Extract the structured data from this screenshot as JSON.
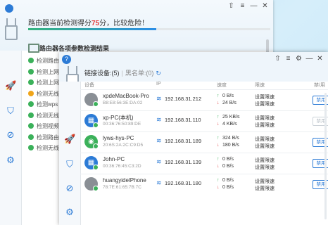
{
  "back_window": {
    "score_prefix": "路由器当前检测得分",
    "score": "75",
    "score_suffix": "分，比较危险！",
    "progress": 0.53,
    "list_title": "路由器各项参数检测结果",
    "items": [
      {
        "label": "检测路由器",
        "status": "ok"
      },
      {
        "label": "检测上网",
        "status": "ok"
      },
      {
        "label": "检测上网",
        "status": "ok"
      },
      {
        "label": "检测无线",
        "status": "warn"
      },
      {
        "label": "检测wps",
        "status": "ok"
      },
      {
        "label": "检测无线",
        "status": "ok"
      },
      {
        "label": "检测视频",
        "status": "ok"
      },
      {
        "label": "检测路由",
        "status": "ok"
      },
      {
        "label": "检测无线",
        "status": "ok"
      }
    ]
  },
  "front_window": {
    "tab_connected": "链接设备:(5)",
    "tab_blacklist": "黑名单:(0)",
    "columns": {
      "device": "设备",
      "ip": "IP",
      "speed": "速度",
      "limit": "限速",
      "ban": "禁/用"
    },
    "devices": [
      {
        "name": "xpdeMacBook-Pro",
        "mac": "B8:E8:56:3E:DA:02",
        "type": "apple",
        "ip": "192.168.31.212",
        "up": "0 B/s",
        "down": "24 B/s",
        "limit_up": "设置限速",
        "limit_down": "设置限速",
        "ban": "禁用",
        "ban_enabled": true
      },
      {
        "name": "xp-PC(本机)",
        "mac": "00:36:76:50:89:DE",
        "type": "windows",
        "ip": "192.168.31.110",
        "up": "25 KB/s",
        "down": "4 KB/s",
        "limit_up": "设置限速",
        "limit_down": "设置限速",
        "ban": "禁用",
        "ban_enabled": false
      },
      {
        "name": "lyws-hys-PC",
        "mac": "20:6S:2A:2C:C9:D5",
        "type": "android",
        "ip": "192.168.31.189",
        "up": "324 B/s",
        "down": "180 B/s",
        "limit_up": "设置限速",
        "limit_down": "设置限速",
        "ban": "禁用",
        "ban_enabled": true
      },
      {
        "name": "John-PC",
        "mac": "00:36:76:45:C3:2D",
        "type": "windows",
        "ip": "192.168.31.139",
        "up": "0 B/s",
        "down": "0 B/s",
        "limit_up": "设置限速",
        "limit_down": "设置限速",
        "ban": "禁用",
        "ban_enabled": true
      },
      {
        "name": "huangyidelPhone",
        "mac": "78:7E:61:65:7B:7C",
        "type": "apple",
        "ip": "192.168.31.180",
        "up": "0 B/s",
        "down": "0 B/s",
        "limit_up": "设置限速",
        "limit_down": "设置限速",
        "ban": "禁用",
        "ban_enabled": true
      }
    ]
  },
  "icons": {
    "rocket": "🚀",
    "shield": "⛉",
    "block": "⊘",
    "gear": "⚙",
    "wifi": "≋",
    "apple": "",
    "windows": "▦",
    "android": "◉",
    "up": "↑",
    "down": "↓",
    "refresh": "↻",
    "minimize": "—",
    "maximize": "☐",
    "close": "✕",
    "skin": "⇧",
    "menu": "≡"
  },
  "colors": {
    "accent": "#2c7bd6",
    "danger": "#e23b3b",
    "ok": "#3bb15a",
    "warn": "#f0a51a"
  }
}
